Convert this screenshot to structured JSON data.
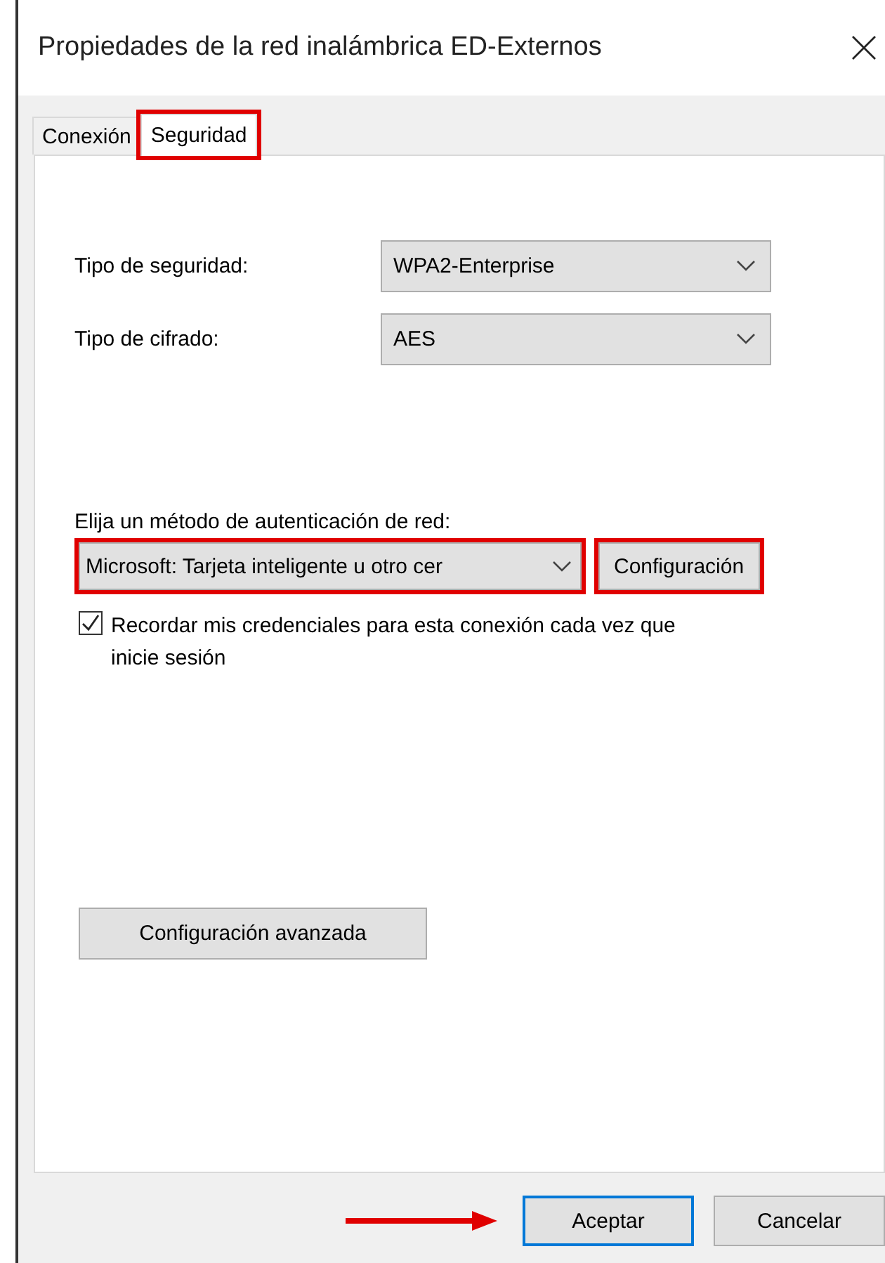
{
  "window": {
    "title": "Propiedades de la red inalámbrica ED-Externos"
  },
  "tabs": [
    {
      "label": "Conexión",
      "selected": false,
      "highlighted": false
    },
    {
      "label": "Seguridad",
      "selected": true,
      "highlighted": true
    }
  ],
  "security_type": {
    "label": "Tipo de seguridad:",
    "value": "WPA2-Enterprise"
  },
  "encryption_type": {
    "label": "Tipo de cifrado:",
    "value": "AES"
  },
  "auth_method": {
    "label": "Elija un método de autenticación de red:",
    "value": "Microsoft: Tarjeta inteligente u otro cer",
    "highlighted": true,
    "button": {
      "label": "Configuración",
      "highlighted": true
    }
  },
  "remember_credentials": {
    "label": "Recordar mis credenciales para esta conexión cada vez que inicie sesión",
    "checked": true
  },
  "advanced_button": {
    "label": "Configuración avanzada"
  },
  "buttons": [
    {
      "label": "Aceptar",
      "default": true,
      "pointed": true
    },
    {
      "label": "Cancelar",
      "default": false,
      "pointed": false
    }
  ]
}
